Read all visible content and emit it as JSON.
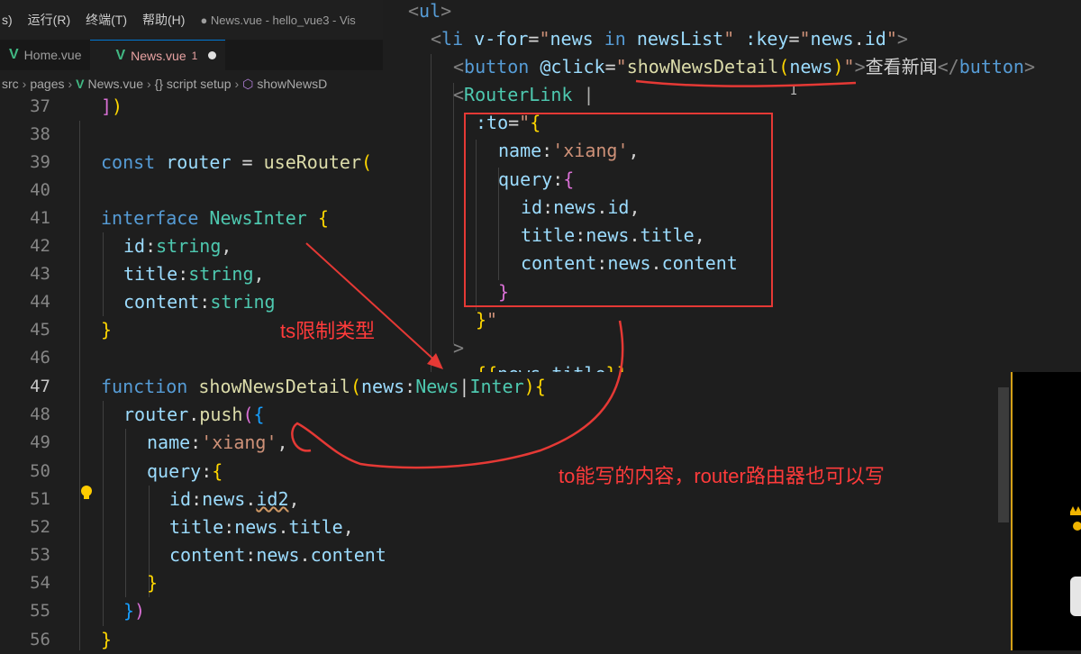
{
  "menubar": {
    "items": [
      "s)",
      "运行(R)",
      "终端(T)",
      "帮助(H)"
    ],
    "title": "● News.vue - hello_vue3 - Vis"
  },
  "tabs": [
    {
      "label": "Home.vue",
      "active": false
    },
    {
      "label": "News.vue",
      "modified_count": "1",
      "active": true
    }
  ],
  "breadcrumb": [
    "src",
    "pages",
    "News.vue",
    "{} script setup",
    "showNewsD"
  ],
  "editor": {
    "line_numbers": [
      "37",
      "38",
      "39",
      "40",
      "41",
      "42",
      "43",
      "44",
      "45",
      "46",
      "47",
      "48",
      "49",
      "50",
      "51",
      "52",
      "53",
      "54",
      "55",
      "56"
    ],
    "current_line": "47"
  },
  "annotations": {
    "ts_note": "ts限制类型",
    "router_note": "to能写的内容，router路由器也可以写"
  },
  "colors": {
    "annotation_red": "#e53935",
    "editor_bg": "#1e1e1e"
  }
}
